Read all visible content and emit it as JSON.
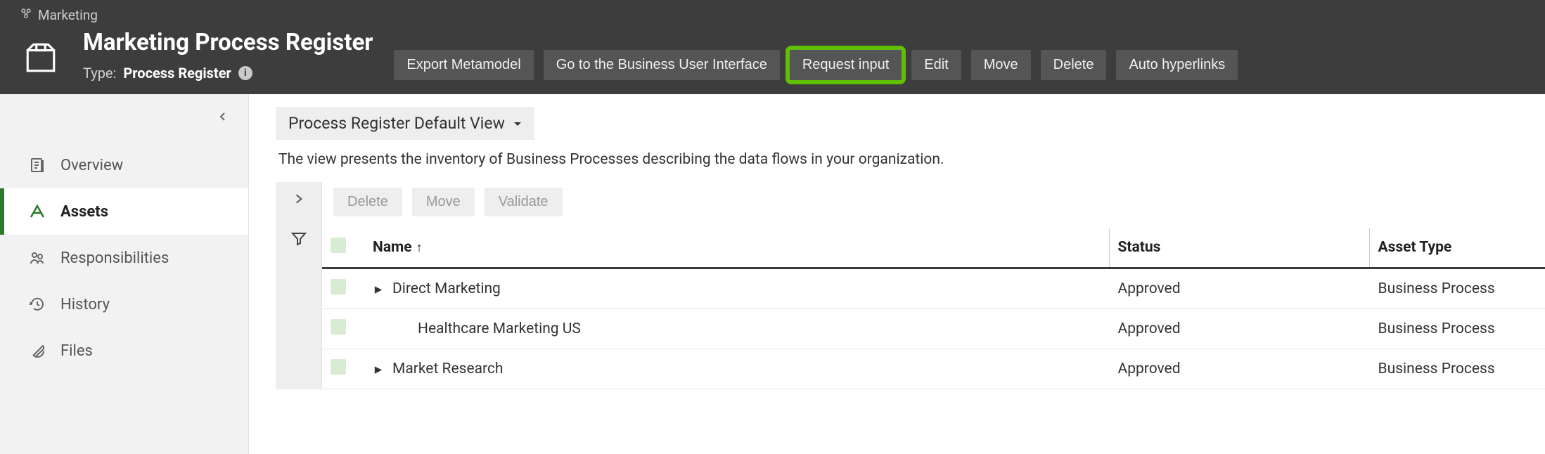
{
  "breadcrumb": {
    "org": "Marketing"
  },
  "header": {
    "title": "Marketing Process Register",
    "type_label": "Type:",
    "type_value": "Process Register",
    "actions": {
      "export": "Export Metamodel",
      "goto_bui": "Go to the Business User Interface",
      "request_input": "Request input",
      "edit": "Edit",
      "move": "Move",
      "delete": "Delete",
      "auto_hyperlinks": "Auto hyperlinks"
    }
  },
  "sidebar": {
    "items": [
      {
        "key": "overview",
        "label": "Overview"
      },
      {
        "key": "assets",
        "label": "Assets"
      },
      {
        "key": "responsibilities",
        "label": "Responsibilities"
      },
      {
        "key": "history",
        "label": "History"
      },
      {
        "key": "files",
        "label": "Files"
      }
    ],
    "active": "assets"
  },
  "main": {
    "view_name": "Process Register Default View",
    "view_description": "The view presents the inventory of Business Processes describing the data flows in your organization.",
    "row_actions": {
      "delete": "Delete",
      "move": "Move",
      "validate": "Validate"
    },
    "columns": {
      "name": "Name",
      "status": "Status",
      "asset_type": "Asset Type"
    },
    "rows": [
      {
        "name": "Direct Marketing",
        "status": "Approved",
        "asset_type": "Business Process",
        "expandable": true,
        "indent": 0
      },
      {
        "name": "Healthcare Marketing US",
        "status": "Approved",
        "asset_type": "Business Process",
        "expandable": false,
        "indent": 1
      },
      {
        "name": "Market Research",
        "status": "Approved",
        "asset_type": "Business Process",
        "expandable": true,
        "indent": 0
      }
    ]
  }
}
